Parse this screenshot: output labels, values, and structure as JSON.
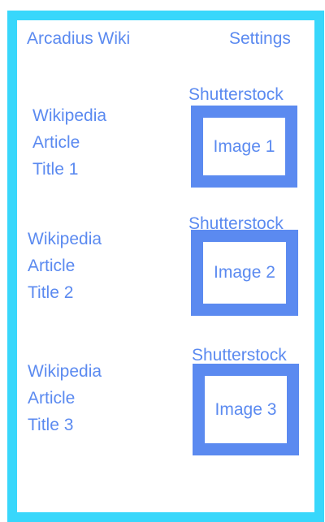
{
  "header": {
    "title": "Arcadius Wiki",
    "settings_label": "Settings"
  },
  "articles": [
    {
      "title_lines": [
        "Wikipedia",
        "Article",
        "Title 1"
      ],
      "image_credit": "Shutterstock",
      "image_label": "Image 1"
    },
    {
      "title_lines": [
        "Wikipedia",
        "Article",
        "Title 2"
      ],
      "image_credit": "Shutterstock",
      "image_label": "Image 2"
    },
    {
      "title_lines": [
        "Wikipedia",
        "Article",
        "Title 3"
      ],
      "image_credit": "Shutterstock",
      "image_label": "Image 3"
    }
  ],
  "colors": {
    "frame_border": "#38d7fb",
    "accent": "#5b8af0"
  }
}
